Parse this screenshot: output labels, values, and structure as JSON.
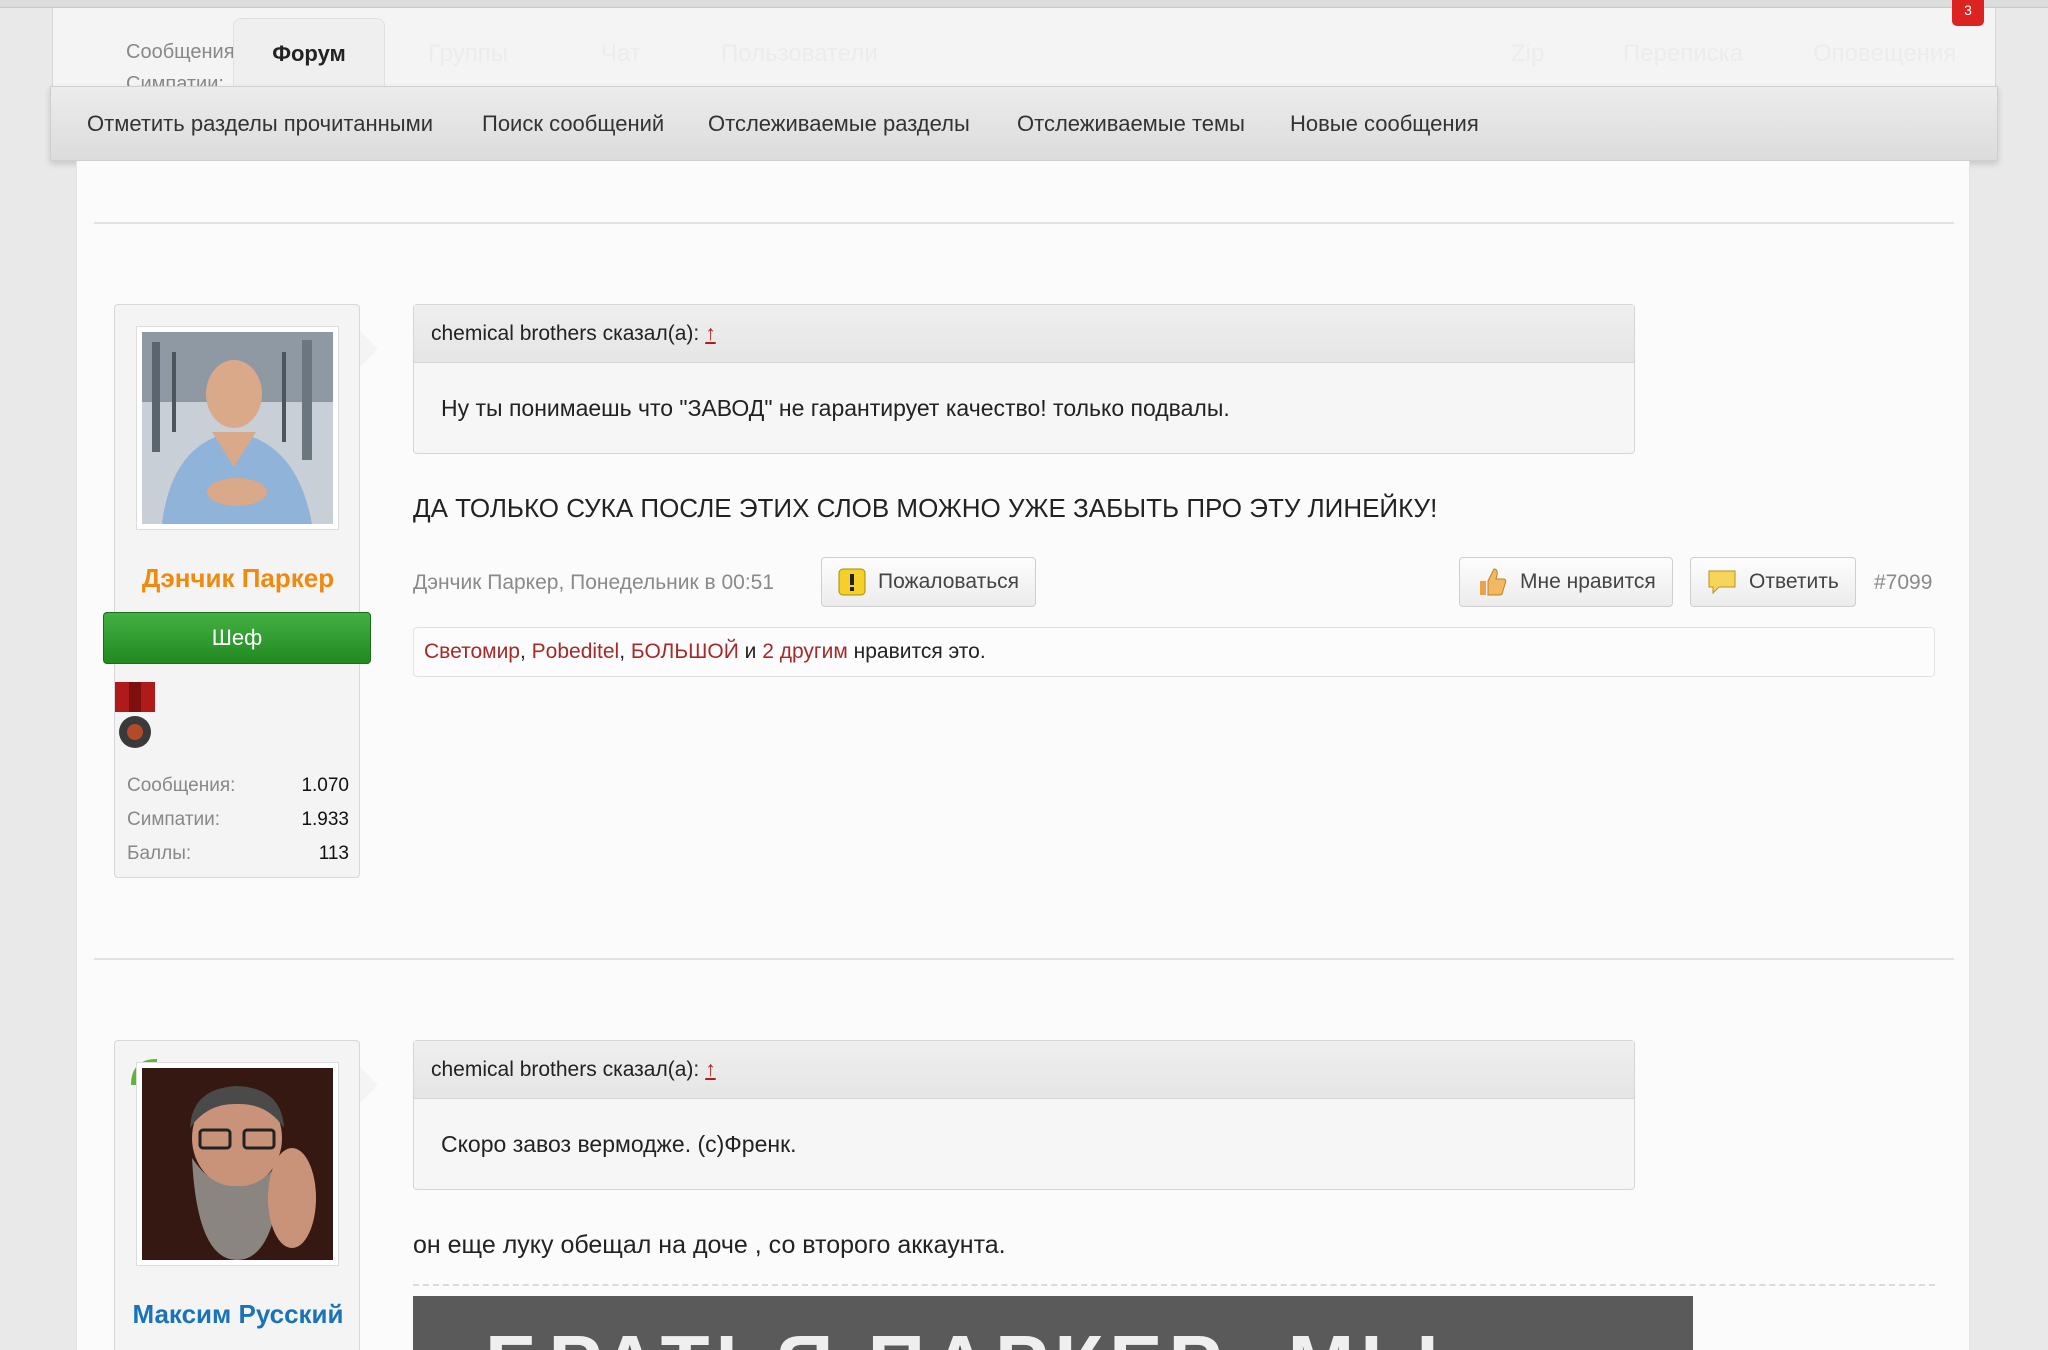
{
  "topnav": {
    "forum_tab": "Форум",
    "bg_stats": [
      "Сообщения",
      "Симпатии:"
    ],
    "ghost_items": [
      "Группы",
      "Чат",
      "Пользователи",
      "Zip",
      "Переписка",
      "Оповещения"
    ],
    "badge": "3"
  },
  "subnav": {
    "items": [
      "Отметить разделы прочитанными",
      "Поиск сообщений",
      "Отслеживаемые разделы",
      "Отслеживаемые темы",
      "Новые сообщения"
    ]
  },
  "posts": [
    {
      "author": "Дэнчик Паркер",
      "author_color": "#f08a0f",
      "rank": "Шеф",
      "stats": [
        {
          "label": "Сообщения:",
          "value": "1.070"
        },
        {
          "label": "Симпатии:",
          "value": "1.933"
        },
        {
          "label": "Баллы:",
          "value": "113"
        }
      ],
      "quote_author": "chemical brothers сказал(а):",
      "quote_arrow": "↑",
      "quote_text": "Ну ты понимаешь что \"ЗАВОД\" не гарантирует качество! только подвалы.",
      "text": "ДА ТОЛЬКО СУКА ПОСЛЕ ЭТИХ СЛОВ МОЖНО УЖЕ ЗАБЫТЬ ПРО ЭТУ ЛИНЕЙКУ!",
      "meta": "Дэнчик Паркер, Понедельник в 00:51",
      "report_label": "Пожаловаться",
      "like_label": "Мне нравится",
      "reply_label": "Ответить",
      "post_number": "#7099",
      "likes": {
        "users": [
          "Светомир",
          "Pobeditel",
          "БОЛЬШОЙ"
        ],
        "and": "и",
        "others": "2 другим",
        "suffix": "нравится это."
      }
    },
    {
      "author": "Максим Русский",
      "author_color": "#1a73b8",
      "quote_author": "chemical brothers сказал(а):",
      "quote_arrow": "↑",
      "quote_text": "Скоро завоз вермодже. (с)Френк.",
      "text": "он еще луку обещал на доче , со второго аккаунта.",
      "image_caption": "БРАТЬЯ ПАРКЕР: МЫ"
    }
  ],
  "colors": {
    "link": "#a52a2a",
    "rank_green": "#2e9e2e"
  }
}
